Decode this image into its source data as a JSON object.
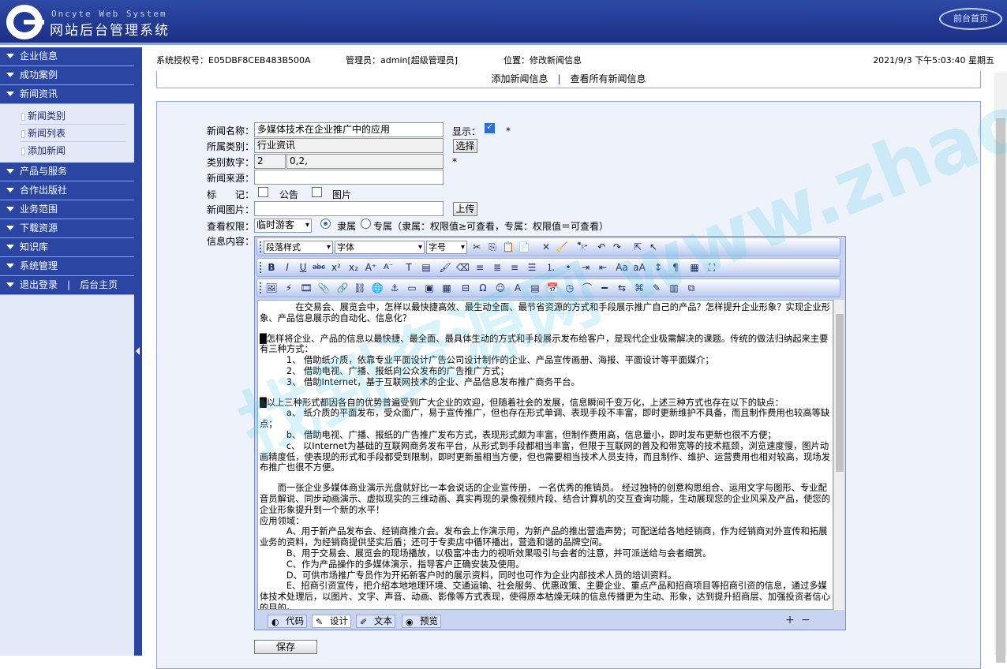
{
  "header": {
    "sys_name": "Oncyte Web System",
    "sys_title": "网站后台管理系统",
    "home_button": "前台首页"
  },
  "sidebar": {
    "menus": [
      {
        "label": "企业信息"
      },
      {
        "label": "成功案例"
      },
      {
        "label": "新闻资讯",
        "expanded": true,
        "subitems": [
          "新闻类别",
          "新闻列表",
          "添加新闻"
        ]
      },
      {
        "label": "产品与服务"
      },
      {
        "label": "合作出版社"
      },
      {
        "label": "业务范围"
      },
      {
        "label": "下载资源"
      },
      {
        "label": "知识库"
      },
      {
        "label": "系统管理"
      }
    ],
    "logout": "退出登录",
    "back_home": "后台主页"
  },
  "topinfo": {
    "license": "系统授权号：E05DBF8CEB483B500A",
    "admin": "管理员：admin[超级管理员]",
    "location": "位置：修改新闻信息",
    "datetime": "2021/9/3 下午5:03:40 星期五"
  },
  "tabs": {
    "add": "添加新闻信息",
    "view_all": "查看所有新闻信息"
  },
  "form": {
    "news_name_label": "新闻名称：",
    "news_name_value": "多媒体技术在企业推广中的应用",
    "display_label": "显示：",
    "display_checked": true,
    "required_mark": "*",
    "category_label": "所属类别：",
    "category_value": "行业资讯",
    "choose_button": "选择",
    "category_num_label": "类别数字：",
    "category_num_value": "2",
    "category_path_value": "0,2,",
    "source_label": "新闻来源：",
    "source_value": "",
    "mark_label": "标　　记：",
    "notice_label": "公告",
    "picture_label": "图片",
    "image_label": "新闻图片：",
    "upload_button": "上传",
    "permission_label": "查看权限：",
    "permission_select": "临时游客",
    "belong_label": "隶属",
    "exclusive_label": "专属（隶属：权限值≥可查看，专属：权限值＝可查看）",
    "content_label": "信息内容："
  },
  "editor": {
    "paragraph_style": "段落样式",
    "font": "字体",
    "font_size": "字号",
    "modes": [
      "代码",
      "设计",
      "文本",
      "预览"
    ],
    "active_mode": "设计",
    "paragraphs": [
      "　　　　在交易会、展览会中，怎样以最快捷高效、最生动全面、最节省资源的方式和手段展示推广自己的产品？怎样提升企业形象？实现企业形象、产品信息展示的自动化、信息化？",
      "",
      "█怎样将企业、产品的信息以最快捷、最全面、最具体生动的方式和手段展示发布给客户，是现代企业极需解决的课题。传统的做法归纳起来主要有三种方式：",
      "　　　1、 借助纸介质，依靠专业平面设计广告公司设计制作的企业、产品宣传画册、海报、平面设计等平面媒介；",
      "　　　2、 借助电视、广播、报纸向公众发布的广告推广方式；",
      "　　　3、 借助Internet，基于互联网技术的企业、产品信息发布推广商务平台。",
      "",
      "█以上三种形式都因各自的优势普遍受到广大企业的欢迎，但随着社会的发展，信息瞬间千变万化，上述三种方式也存在以下的缺点：",
      "　　　a、 纸介质的平面发布，受众面广，易于宣传推广，但也存在形式单调、表现手段不丰富，即时更新维护不具备，而且制作费用也较高等缺点；",
      "　　　b、 借助电视、广播、报纸的广告推广发布方式，表现形式颇为丰富，但制作费用高，信息量小，即时发布更新也很不方便；",
      "　　　c、 以Internet为基础的互联网商务发布平台，从形式到手段都相当丰富，但限于互联网的普及和带宽等的技术瓶颈，浏览速度慢，图片动画精度低，使表现的形式和手段都受到限制，即时更新虽相当方便，但也需要相当技术人员支持，而且制作、维护、运营费用也相对较高，现场发布推广也很不方便。",
      "",
      "　　而一张企业多媒体商业演示光盘就好比一本会说话的企业宣传册， 一名优秀的推销员。 经过独特的创意构思组合、运用文字与图形、专业配音员解说、同步动画演示、虚拟现实的三维动画、真实再现的录像视频片段、结合计算机的交互查询功能，生动展现您的企业风采及产品，使您的企业形象提升到一个新的水平！",
      "应用领域：",
      "　　　A、用于新产品发布会、经销商推介会。发布会上作演示用，为新产品的推出营造声势；可配送给各地经销商，作为经销商对外宣传和拓展业务的资料，为经销商提供坚实后盾；还可于专卖店中循环播出，营造和谐的品牌空间。",
      "　　　B、用于交易会、展览会的现场播放，以极富冲击力的视听效果吸引与会者的注意，并可派送给与会者细赏。",
      "　　　C、作为产品操作的多媒体演示，指导客户正确安装及使用。",
      "　　　D、可供市场推广专员作为开拓新客户时的展示资料，同时也可作为企业内部技术人员的培训资料。",
      "　　　E、招商引资宣传，把介绍本地地理环境、交通运输、社会服务、优惠政策、主要企业、重点产品和招商项目等招商引资的信息，通过多媒体技术处理后，以图片、文字、声音、动画、影像等方式表现，使得原本枯燥无味的信息传播更为生动、形象，达到提升招商层、加强投资者信心的目的。"
    ]
  },
  "save_button": "保存",
  "watermark": "找到资源网 www.zhaodaima.cc"
}
